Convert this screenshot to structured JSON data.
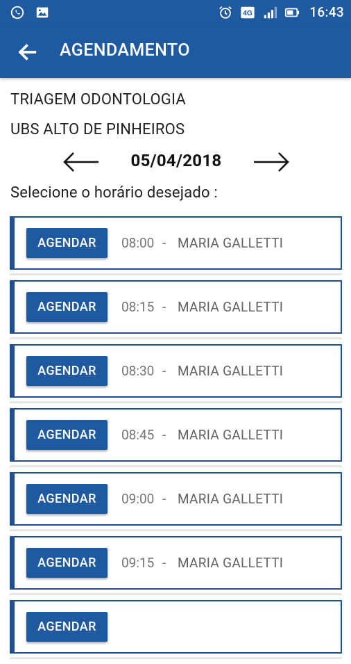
{
  "status_bar": {
    "time": "16:43",
    "network": "4G",
    "left_icons": [
      "whatsapp-icon",
      "image-icon"
    ],
    "right_icons": [
      "alarm-icon",
      "network-4g-icon",
      "signal-icon",
      "battery-icon"
    ]
  },
  "app_bar": {
    "title": "AGENDAMENTO",
    "back_icon": "arrow-back-icon",
    "color": "#1f5aa0"
  },
  "header": {
    "specialty": "TRIAGEM ODONTOLOGIA",
    "unit": "UBS ALTO DE PINHEIROS"
  },
  "date_nav": {
    "date": "05/04/2018",
    "prev_icon": "arrow-left-icon",
    "next_icon": "arrow-right-icon"
  },
  "prompt": "Selecione o horário desejado :",
  "slots": [
    {
      "button_label": "AGENDAR",
      "time": "08:00",
      "separator": "-",
      "professional": "MARIA GALLETTI"
    },
    {
      "button_label": "AGENDAR",
      "time": "08:15",
      "separator": "-",
      "professional": "MARIA GALLETTI"
    },
    {
      "button_label": "AGENDAR",
      "time": "08:30",
      "separator": "-",
      "professional": "MARIA GALLETTI"
    },
    {
      "button_label": "AGENDAR",
      "time": "08:45",
      "separator": "-",
      "professional": "MARIA GALLETTI"
    },
    {
      "button_label": "AGENDAR",
      "time": "09:00",
      "separator": "-",
      "professional": "MARIA GALLETTI"
    },
    {
      "button_label": "AGENDAR",
      "time": "09:15",
      "separator": "-",
      "professional": "MARIA GALLETTI"
    },
    {
      "button_label": "AGENDAR",
      "time": "",
      "separator": "",
      "professional": ""
    }
  ],
  "colors": {
    "primary": "#1f5aa0",
    "slot_border": "#1f4f94",
    "muted_text": "#757575"
  }
}
